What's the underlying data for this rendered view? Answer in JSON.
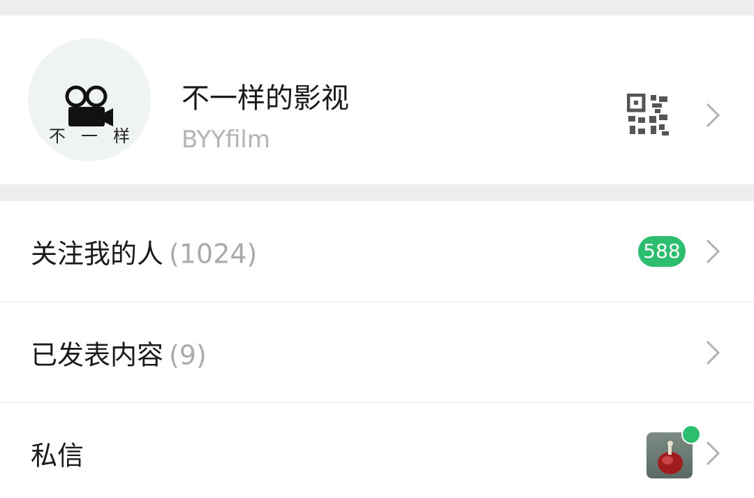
{
  "profile": {
    "name": "不一样的影视",
    "id": "BYYfilm",
    "avatar_text": "不一样"
  },
  "menu": [
    {
      "label": "关注我的人",
      "count": "(1024)",
      "badge": "588"
    },
    {
      "label": "已发表内容",
      "count": "(9)"
    },
    {
      "label": "私信",
      "has_unread_dot": true
    }
  ],
  "icons": {
    "qr": "qr-code-icon",
    "chevron": "chevron-right-icon",
    "avatar": "movie-camera-icon"
  },
  "colors": {
    "accent_green": "#2dbd6e",
    "background": "#ededed",
    "text_secondary": "#aaaaaa"
  }
}
